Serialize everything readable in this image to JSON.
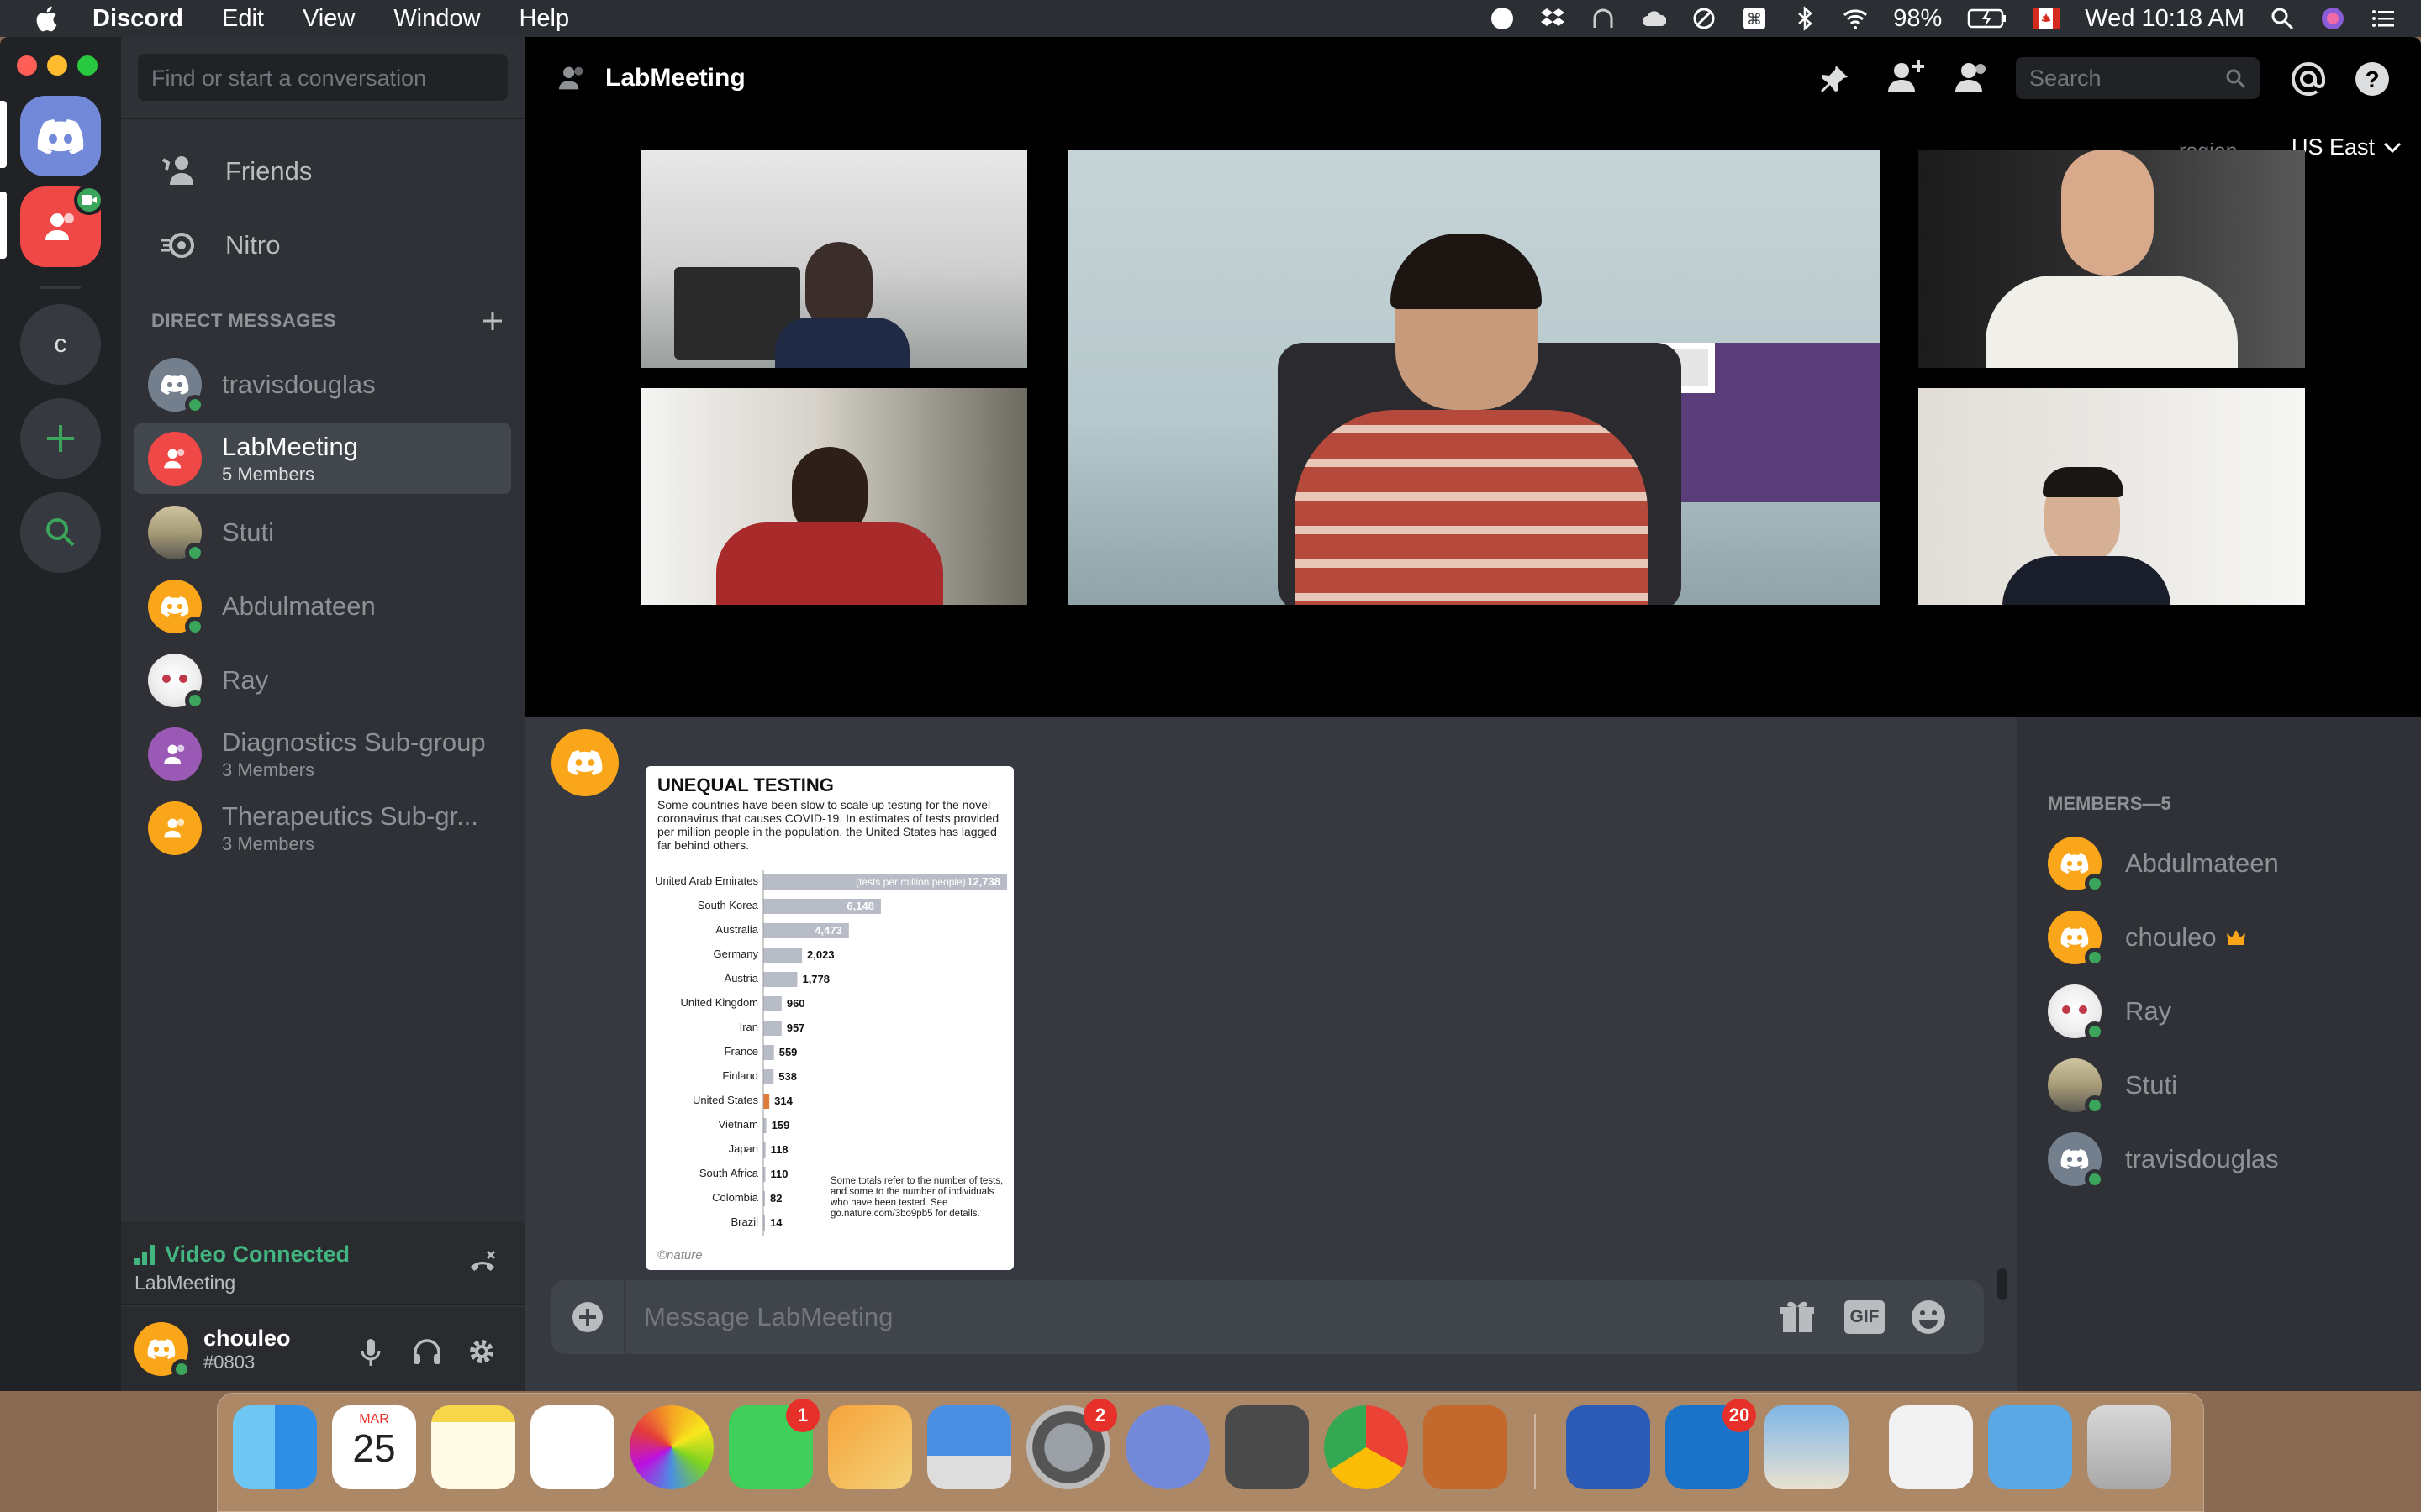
{
  "menubar": {
    "app_name": "Discord",
    "menus": [
      "Edit",
      "View",
      "Window",
      "Help"
    ],
    "battery": "98%",
    "clock": "Wed 10:18 AM"
  },
  "sidebar": {
    "search_placeholder": "Find or start a conversation",
    "friends": "Friends",
    "nitro": "Nitro",
    "direct_messages_header": "DIRECT MESSAGES",
    "guild_letter": "c",
    "dms": [
      {
        "name": "travisdouglas",
        "sub": ""
      },
      {
        "name": "LabMeeting",
        "sub": "5 Members"
      },
      {
        "name": "Stuti",
        "sub": ""
      },
      {
        "name": "Abdulmateen",
        "sub": ""
      },
      {
        "name": "Ray",
        "sub": ""
      },
      {
        "name": "Diagnostics Sub-group",
        "sub": "3 Members"
      },
      {
        "name": "Therapeutics Sub-gr...",
        "sub": "3 Members"
      }
    ],
    "voice_status": "Video Connected",
    "voice_channel": "LabMeeting",
    "username": "chouleo",
    "discriminator": "#0803"
  },
  "channel": {
    "name": "LabMeeting",
    "search_placeholder": "Search",
    "region_label": "region",
    "region_value": "US East",
    "message_placeholder": "Message LabMeeting",
    "gif_label": "GIF"
  },
  "members": {
    "header": "MEMBERS—5",
    "list": [
      "Abdulmateen",
      "chouleo",
      "Ray",
      "Stuti",
      "travisdouglas"
    ]
  },
  "attachment": {
    "title": "UNEQUAL TESTING",
    "description": "Some countries have been slow to scale up testing for the novel coronavirus that causes COVID-19. In estimates of tests provided per million people in the population, the United States has lagged far behind others.",
    "unit_note": "(tests per million people)",
    "footnote": "Some totals refer to the number of tests, and some to the number of individuals who have been tested. See go.nature.com/3bo9pb5 for details.",
    "credit": "©nature"
  },
  "chart_data": {
    "type": "bar",
    "title": "UNEQUAL TESTING",
    "categories": [
      "United Arab Emirates",
      "South Korea",
      "Australia",
      "Germany",
      "Austria",
      "United Kingdom",
      "Iran",
      "France",
      "Finland",
      "United States",
      "Vietnam",
      "Japan",
      "South Africa",
      "Colombia",
      "Brazil"
    ],
    "value_labels": [
      "12,738",
      "6,148",
      "4,473",
      "2,023",
      "1,778",
      "960",
      "957",
      "559",
      "538",
      "314",
      "159",
      "118",
      "110",
      "82",
      "14"
    ],
    "values": [
      12738,
      6148,
      4473,
      2023,
      1778,
      960,
      957,
      559,
      538,
      314,
      159,
      118,
      110,
      82,
      14
    ],
    "highlight": "United States",
    "highlight_color": "#e07b39",
    "bar_color": "#b8bcc6"
  },
  "dock": {
    "calendar_month": "MAR",
    "calendar_day": "25",
    "facetime_badge": "1",
    "prefs_badge": "2",
    "outlook_badge": "20"
  },
  "colors": {
    "discord_blurple": "#7289da",
    "online": "#3ba55c",
    "accent_red": "#f04747",
    "avatar_orange": "#faa61a"
  }
}
